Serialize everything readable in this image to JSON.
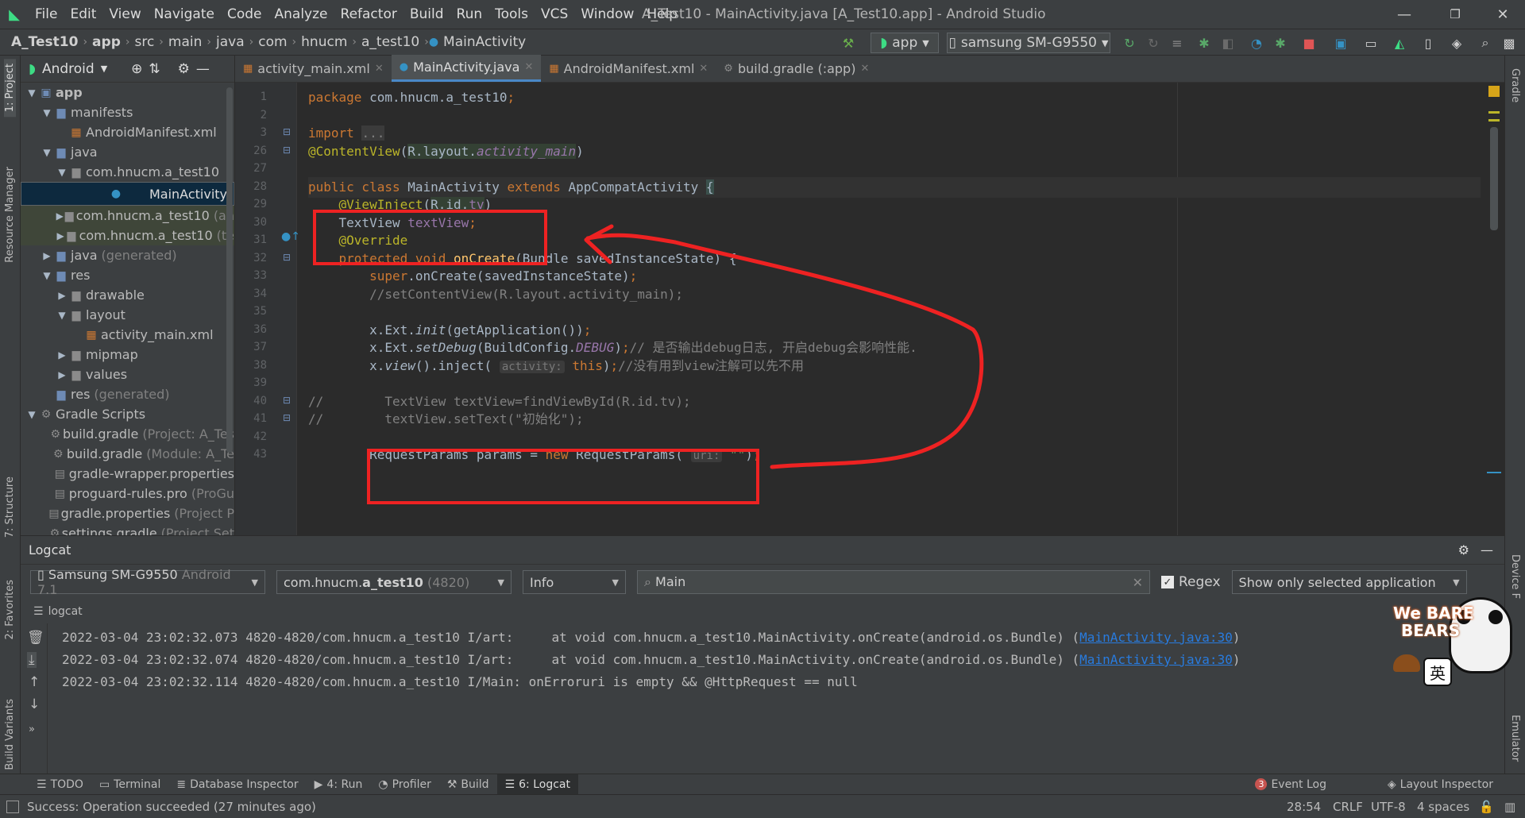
{
  "menubar": {
    "items": [
      "File",
      "Edit",
      "View",
      "Navigate",
      "Code",
      "Analyze",
      "Refactor",
      "Build",
      "Run",
      "Tools",
      "VCS",
      "Window",
      "Help"
    ],
    "title": "A_Test10 - MainActivity.java [A_Test10.app] - Android Studio",
    "minimize": "—",
    "maximize": "❐",
    "close": "✕"
  },
  "breadcrumb": [
    "A_Test10",
    "app",
    "src",
    "main",
    "java",
    "com",
    "hnucm",
    "a_test10",
    "MainActivity"
  ],
  "toolbar": {
    "config": "app",
    "device": "samsung SM-G9550"
  },
  "leftstrip": {
    "project": "1: Project",
    "resource_manager": "Resource Manager",
    "structure": "7: Structure",
    "favorites": "2: Favorites",
    "build_variants": "Build Variants"
  },
  "rightstrip": {
    "gradle": "Gradle",
    "device_file": "Device F",
    "emulator": "Emulator"
  },
  "project": {
    "view": "Android",
    "tree": [
      {
        "label": "app",
        "gray": "",
        "arrow": "▼",
        "icon": "▣",
        "color": "#6e8bb5",
        "d": 0,
        "bold": true
      },
      {
        "label": "manifests",
        "gray": "",
        "arrow": "▼",
        "icon": "▆",
        "color": "#6e8bb5",
        "d": 1
      },
      {
        "label": "AndroidManifest.xml",
        "gray": "",
        "arrow": "",
        "icon": "▦",
        "color": "#cc7832",
        "d": 2
      },
      {
        "label": "java",
        "gray": "",
        "arrow": "▼",
        "icon": "▆",
        "color": "#6e8bb5",
        "d": 1
      },
      {
        "label": "com.hnucm.a_test10",
        "gray": "",
        "arrow": "▼",
        "icon": "▆",
        "color": "#8b8b8b",
        "d": 2
      },
      {
        "label": "MainActivity",
        "gray": "",
        "arrow": "",
        "icon": "●",
        "color": "#3592c4",
        "d": 3,
        "sel": true
      },
      {
        "label": "com.hnucm.a_test10",
        "gray": "(an",
        "arrow": "▶",
        "icon": "▆",
        "color": "#8b8b8b",
        "d": 2,
        "hl": true
      },
      {
        "label": "com.hnucm.a_test10",
        "gray": "(te",
        "arrow": "▶",
        "icon": "▆",
        "color": "#8b8b8b",
        "d": 2,
        "hl": true
      },
      {
        "label": "java",
        "gray": "(generated)",
        "arrow": "▶",
        "icon": "▆",
        "color": "#6e8bb5",
        "d": 1
      },
      {
        "label": "res",
        "gray": "",
        "arrow": "▼",
        "icon": "▆",
        "color": "#6e8bb5",
        "d": 1
      },
      {
        "label": "drawable",
        "gray": "",
        "arrow": "▶",
        "icon": "▆",
        "color": "#8b8b8b",
        "d": 2
      },
      {
        "label": "layout",
        "gray": "",
        "arrow": "▼",
        "icon": "▆",
        "color": "#8b8b8b",
        "d": 2
      },
      {
        "label": "activity_main.xml",
        "gray": "",
        "arrow": "",
        "icon": "▦",
        "color": "#cc7832",
        "d": 3
      },
      {
        "label": "mipmap",
        "gray": "",
        "arrow": "▶",
        "icon": "▆",
        "color": "#8b8b8b",
        "d": 2
      },
      {
        "label": "values",
        "gray": "",
        "arrow": "▶",
        "icon": "▆",
        "color": "#8b8b8b",
        "d": 2
      },
      {
        "label": "res",
        "gray": "(generated)",
        "arrow": "",
        "icon": "▆",
        "color": "#6e8bb5",
        "d": 1
      },
      {
        "label": "Gradle Scripts",
        "gray": "",
        "arrow": "▼",
        "icon": "⚙",
        "color": "#8b8b8b",
        "d": 0
      },
      {
        "label": "build.gradle",
        "gray": "(Project: A_Tes",
        "arrow": "",
        "icon": "⚙",
        "color": "#8b8b8b",
        "d": 1
      },
      {
        "label": "build.gradle",
        "gray": "(Module: A_Te",
        "arrow": "",
        "icon": "⚙",
        "color": "#8b8b8b",
        "d": 1
      },
      {
        "label": "gradle-wrapper.properties",
        "gray": "",
        "arrow": "",
        "icon": "▤",
        "color": "#8b8b8b",
        "d": 1
      },
      {
        "label": "proguard-rules.pro",
        "gray": "(ProGu",
        "arrow": "",
        "icon": "▤",
        "color": "#8b8b8b",
        "d": 1
      },
      {
        "label": "gradle.properties",
        "gray": "(Project P",
        "arrow": "",
        "icon": "▤",
        "color": "#8b8b8b",
        "d": 1
      },
      {
        "label": "settings.gradle",
        "gray": "(Project Set",
        "arrow": "",
        "icon": "⚙",
        "color": "#8b8b8b",
        "d": 1
      }
    ]
  },
  "tabs": [
    {
      "label": "activity_main.xml",
      "icon": "▦",
      "color": "#cc7832",
      "active": false
    },
    {
      "label": "MainActivity.java",
      "icon": "●",
      "color": "#3592c4",
      "active": true
    },
    {
      "label": "AndroidManifest.xml",
      "icon": "▦",
      "color": "#cc7832",
      "active": false
    },
    {
      "label": "build.gradle (:app)",
      "icon": "⚙",
      "color": "#8b8b8b",
      "active": false
    }
  ],
  "code_lines": [
    {
      "n": "1",
      "html": "<span class='kw'>package </span><span class='pl'>com.hnucm.a_test10</span><span class='kw'>;</span>"
    },
    {
      "n": "2",
      "html": ""
    },
    {
      "n": "3",
      "html": "<span class='kw'>import </span><span class='cm' style='background:#3b3b3b'>...</span>"
    },
    {
      "n": "26",
      "html": "<span class='an'>@ContentView</span><span class='pl'>(</span><span class='pl' style='background:#344134'>R.layout.</span><span class='it' style='background:#344134'>activity_main</span><span class='pl'>)</span>"
    },
    {
      "n": "27",
      "html": ""
    },
    {
      "n": "28",
      "html": "<span class='kw'>public class </span><span class='pl'>MainActivity </span><span class='kw'>extends </span><span class='pl'>AppCompatActivity </span><span class='pl' style='background:#3b514d'>{</span>",
      "cur": true
    },
    {
      "n": "29",
      "html": "    <span class='an'>@ViewInject</span><span class='pl'>(</span><span class='pl' style='background:#344134'>R.id.</span><span class='fd' style='background:#344134'>tv</span><span class='pl'>)</span>"
    },
    {
      "n": "30",
      "html": "    <span class='pl'>TextView </span><span class='fd'>textView</span><span class='kw'>;</span>"
    },
    {
      "n": "31",
      "html": "    <span class='an'>@Override</span>"
    },
    {
      "n": "32",
      "html": "    <span class='kw'>protected void </span><span class='fn'>onCreate</span><span class='pl'>(Bundle savedInstanceState) {</span>"
    },
    {
      "n": "33",
      "html": "        <span class='kw'>super</span><span class='pl'>.onCreate(savedInstanceState)</span><span class='kw'>;</span>"
    },
    {
      "n": "34",
      "html": "        <span class='cm'>//setContentView(R.layout.activity_main);</span>"
    },
    {
      "n": "35",
      "html": ""
    },
    {
      "n": "36",
      "html": "        <span class='pl'>x.Ext.</span><span style='font-style:italic;color:#a9b7c6'>init</span><span class='pl'>(getApplication())</span><span class='kw'>;</span>"
    },
    {
      "n": "37",
      "html": "        <span class='pl'>x.Ext.</span><span style='font-style:italic;color:#a9b7c6'>setDebug</span><span class='pl'>(BuildConfig.</span><span class='it'>DEBUG</span><span class='pl'>)</span><span class='kw'>;</span><span class='cm'>// 是否输出debug日志, 开启debug会影响性能.</span>"
    },
    {
      "n": "38",
      "html": "        <span class='pl'>x.</span><span style='font-style:italic;color:#a9b7c6'>view</span><span class='pl'>().inject( </span><span class='ht'>activity:</span><span class='kw'> this</span><span class='pl'>)</span><span class='kw'>;</span><span class='cm'>//没有用到view注解可以先不用</span>"
    },
    {
      "n": "39",
      "html": ""
    },
    {
      "n": "40",
      "html": "<span class='cm'>//        TextView textView=findViewById(R.id.tv);</span>"
    },
    {
      "n": "41",
      "html": "<span class='cm'>//        textView.setText(\"初始化\");</span>"
    },
    {
      "n": "42",
      "html": ""
    },
    {
      "n": "43",
      "html": "        <span class='pl'>RequestParams params = </span><span class='kw'>new </span><span class='pl'>RequestParams( </span><span class='ht'>uri:</span><span class='st'> \"\"</span><span class='pl'>)</span><span class='kw'>;</span>"
    }
  ],
  "logcat": {
    "title": "Logcat",
    "device": "Samsung SM-G9550",
    "device_gray": "Android 7.1",
    "process_pre": "com.hnucm.",
    "process_bold": "a_test10",
    "process_gray": "(4820)",
    "level": "Info",
    "search": "Main",
    "regex": "Regex",
    "filter": "Show only selected application",
    "sub": "logcat",
    "lines": [
      {
        "text": "2022-03-04 23:02:32.073 4820-4820/com.hnucm.a_test10 I/art:     at void com.hnucm.a_test10.MainActivity.onCreate(android.os.Bundle) (",
        "link": "MainActivity.java:30",
        "end": ")"
      },
      {
        "text": "2022-03-04 23:02:32.074 4820-4820/com.hnucm.a_test10 I/art:     at void com.hnucm.a_test10.MainActivity.onCreate(android.os.Bundle) (",
        "link": "MainActivity.java:30",
        "end": ")"
      },
      {
        "text": "2022-03-04 23:02:32.114 4820-4820/com.hnucm.a_test10 I/Main: onErroruri is empty && @HttpRequest == null",
        "link": "",
        "end": ""
      }
    ]
  },
  "bottomtabs": [
    {
      "label": "TODO",
      "icon": "☰"
    },
    {
      "label": "Terminal",
      "icon": "▭"
    },
    {
      "label": "Database Inspector",
      "icon": "≣"
    },
    {
      "label": "4: Run",
      "icon": "▶"
    },
    {
      "label": "Profiler",
      "icon": "◔"
    },
    {
      "label": "Build",
      "icon": "⚒"
    },
    {
      "label": "6: Logcat",
      "icon": "☰",
      "active": true
    }
  ],
  "bottomright": {
    "event_log": "Event Log",
    "event_count": "3",
    "layout_inspector": "Layout Inspector"
  },
  "status": {
    "message": "Success: Operation succeeded (27 minutes ago)",
    "position": "28:54",
    "line_sep": "CRLF",
    "encoding": "UTF-8",
    "indent": "4 spaces"
  },
  "sticker": {
    "line1": "We BARE",
    "line2": "BEARS",
    "badge": "英"
  },
  "colors": {
    "annotation_red": "#ee2222",
    "accent": "#4a88c7"
  }
}
